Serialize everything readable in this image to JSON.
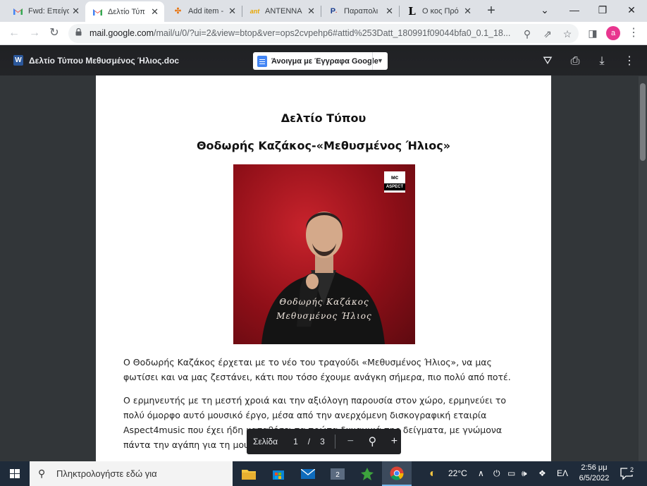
{
  "tabs": [
    {
      "icon": "gmail-icon",
      "title": "Fwd: Επείγο"
    },
    {
      "icon": "gmail-icon",
      "title": "Δελτίο Τύπ",
      "active": true
    },
    {
      "icon": "puzzle-icon",
      "title": "Add item -"
    },
    {
      "icon": "antenna-icon",
      "title": "ANTENNA"
    },
    {
      "icon": "parapolitika-icon",
      "title": "Παραπολι"
    },
    {
      "icon": "l-icon",
      "title": "Ο κος Πρό"
    }
  ],
  "address": {
    "domain": "mail.google.com",
    "path": "/mail/u/0/?ui=2&view=btop&ver=ops2cvpehp6#attid%253Datt_180991f09044bfa0_0.1_18...",
    "profile_initial": "a"
  },
  "viewer": {
    "doc_name": "Δελτίο Τύπου Μεθυσμένος Ήλιος.doc",
    "open_with_label": "Άνοιγμα με Έγγραφα Google"
  },
  "document": {
    "heading": "Δελτίο Τύπου",
    "subheading": "Θοδωρής Καζάκος-«Μεθυσμένος Ήλιος»",
    "cover": {
      "logo_top": "ᴍc",
      "logo_bottom": "ASPECT",
      "line1": "Θοδωρής Καζάκος",
      "line2": "Μεθυσμένος Ήλιος"
    },
    "paragraphs": [
      "Ο Θοδωρής Καζάκος έρχεται με το νέο του τραγούδι «Μεθυσμένος Ήλιος», να μας φωτίσει και να μας ζεστάνει, κάτι που τόσο έχουμε ανάγκη σήμερα, πιο πολύ από ποτέ.",
      "Ο ερμηνευτής με τη μεστή χροιά και την αξιόλογη παρουσία στον χώρο, ερμηνεύει το πολύ όμορφο αυτό μουσικό έργο, μέσα από την ανερχόμενη δισκογραφική εταιρία Aspect4music που έχει ήδη καταθέσει τα πρώτα δυναμικά της δείγματα, με γνώμονα πάντα την αγάπη για τη μουσική και το τραγούδι."
    ]
  },
  "page_control": {
    "label": "Σελίδα",
    "current": "1",
    "separator": "/",
    "total": "3"
  },
  "taskbar": {
    "search_placeholder": "Πληκτρολογήστε εδώ για",
    "temperature": "22°C",
    "language": "ΕΛ",
    "time": "2:56 μμ",
    "date": "6/5/2022",
    "notification_count": "2"
  },
  "colors": {
    "viewer_bg": "#323639",
    "taskbar_bg": "#1f2b3a",
    "cover_red": "#a5121c"
  }
}
